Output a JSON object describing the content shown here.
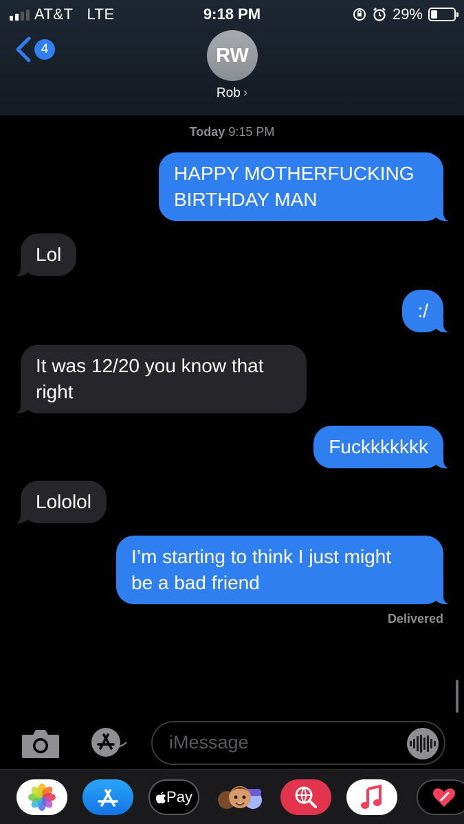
{
  "status_bar": {
    "carrier": "AT&T",
    "network": "LTE",
    "time": "9:18 PM",
    "battery_percent": "29%",
    "battery_level": 0.29,
    "icons": [
      "signal-icon",
      "orientation-lock-icon",
      "alarm-icon",
      "battery-icon"
    ]
  },
  "header": {
    "back_count": "4",
    "avatar_initials": "RW",
    "contact_name": "Rob",
    "chevron": "›"
  },
  "conversation": {
    "timestamp_day": "Today",
    "timestamp_time": "9:15 PM",
    "messages": [
      {
        "from": "me",
        "text": "HAPPY MOTHERFUCKING\nBIRTHDAY MAN"
      },
      {
        "from": "them",
        "text": "Lol"
      },
      {
        "from": "me",
        "text": ":/"
      },
      {
        "from": "them",
        "text": "It was 12/20 you know that\nright"
      },
      {
        "from": "me",
        "text": "Fuckkkkkkk"
      },
      {
        "from": "them",
        "text": "Lololol"
      },
      {
        "from": "me",
        "text": "I’m starting to think I just might\nbe a bad friend"
      }
    ],
    "status": "Delivered"
  },
  "composer": {
    "placeholder": "iMessage",
    "icons": [
      "camera-icon",
      "app-store-icon",
      "audio-message-icon"
    ]
  },
  "app_drawer": {
    "apps": [
      {
        "name": "photos-app-icon"
      },
      {
        "name": "app-store-app-icon"
      },
      {
        "name": "apple-pay-app-icon",
        "label": "Pay"
      },
      {
        "name": "memoji-app-icon"
      },
      {
        "name": "web-search-app-icon"
      },
      {
        "name": "music-app-icon"
      },
      {
        "name": "digital-touch-app-icon"
      }
    ]
  },
  "colors": {
    "outgoing_bubble": "#2f7ff0",
    "incoming_bubble": "#26262a",
    "background": "#000000",
    "secondary_text": "#8e8e93"
  }
}
